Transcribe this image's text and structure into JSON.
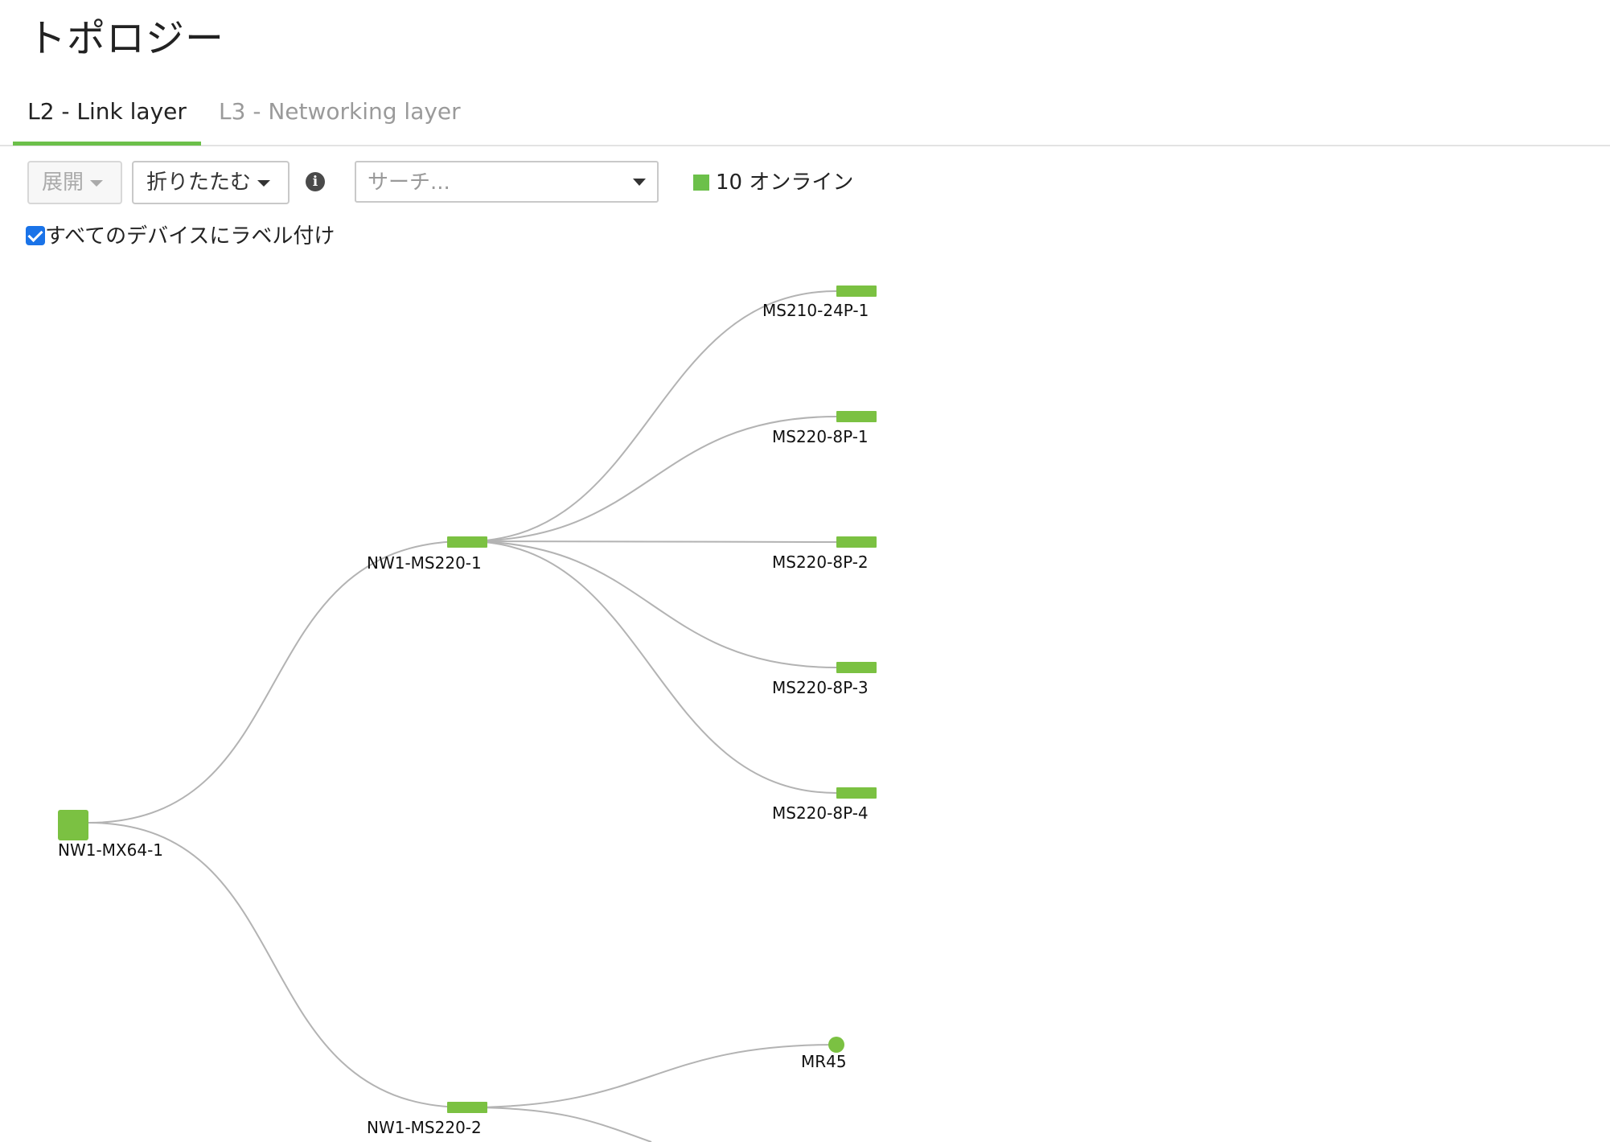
{
  "page": {
    "title": "トポロジー"
  },
  "tabs": [
    {
      "label": "L2 - Link layer",
      "active": true
    },
    {
      "label": "L3 - Networking layer",
      "active": false
    }
  ],
  "toolbar": {
    "expand_label": "展開",
    "collapse_label": "折りたたむ",
    "info_icon": "info-icon",
    "search_placeholder": "サーチ...",
    "online_status": "10 オンライン",
    "online_color": "#6cc04a"
  },
  "options": {
    "label_all_devices": "すべてのデバイスにラベル付け",
    "label_all_checked": true
  },
  "topology": {
    "nodes": [
      {
        "id": "nw1-mx64-1",
        "label": "NW1-MX64-1",
        "type": "appliance"
      },
      {
        "id": "nw1-ms220-1",
        "label": "NW1-MS220-1",
        "type": "switch"
      },
      {
        "id": "nw1-ms220-2",
        "label": "NW1-MS220-2",
        "type": "switch"
      },
      {
        "id": "ms210-24p-1",
        "label": "MS210-24P-1",
        "type": "switch"
      },
      {
        "id": "ms220-8p-1",
        "label": "MS220-8P-1",
        "type": "switch"
      },
      {
        "id": "ms220-8p-2",
        "label": "MS220-8P-2",
        "type": "switch"
      },
      {
        "id": "ms220-8p-3",
        "label": "MS220-8P-3",
        "type": "switch"
      },
      {
        "id": "ms220-8p-4",
        "label": "MS220-8P-4",
        "type": "switch"
      },
      {
        "id": "mr45",
        "label": "MR45",
        "type": "access-point"
      }
    ],
    "links": [
      {
        "from": "nw1-mx64-1",
        "to": "nw1-ms220-1"
      },
      {
        "from": "nw1-mx64-1",
        "to": "nw1-ms220-2"
      },
      {
        "from": "nw1-ms220-1",
        "to": "ms210-24p-1"
      },
      {
        "from": "nw1-ms220-1",
        "to": "ms220-8p-1"
      },
      {
        "from": "nw1-ms220-1",
        "to": "ms220-8p-2"
      },
      {
        "from": "nw1-ms220-1",
        "to": "ms220-8p-3"
      },
      {
        "from": "nw1-ms220-1",
        "to": "ms220-8p-4"
      },
      {
        "from": "nw1-ms220-2",
        "to": "mr45"
      },
      {
        "from": "nw1-ms220-2",
        "to": "offscreen"
      }
    ],
    "node_color": "#7bc142",
    "link_color": "#b3b3b3"
  }
}
